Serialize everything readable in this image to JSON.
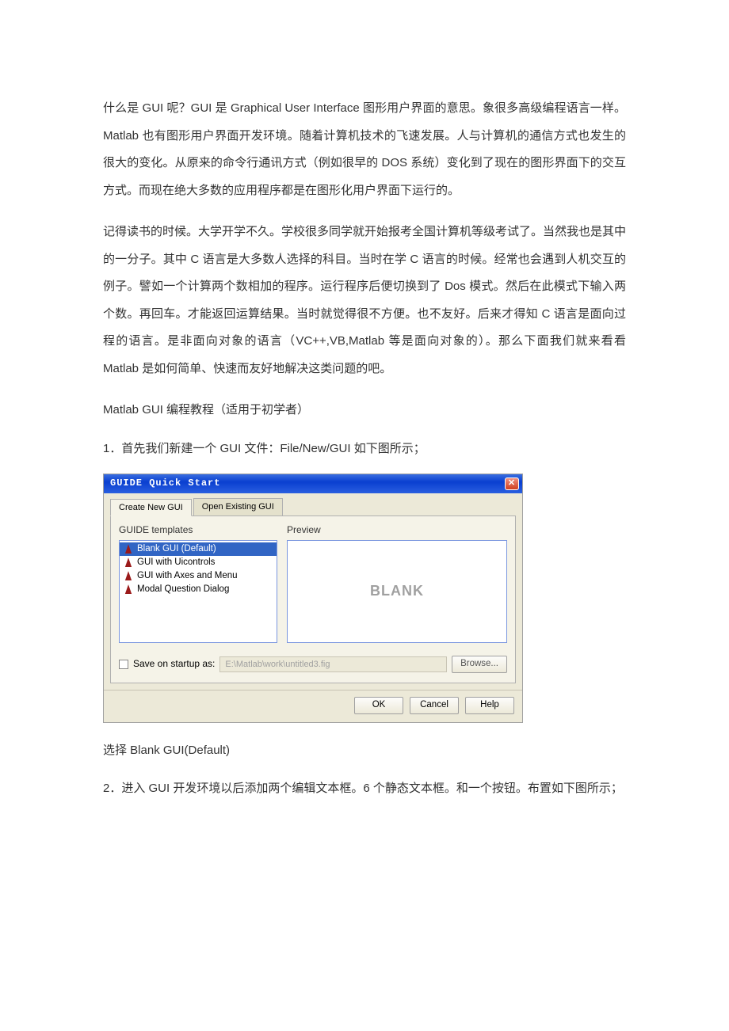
{
  "body": {
    "p1": "什么是 GUI 呢？GUI 是 Graphical User Interface 图形用户界面的意思。象很多高级编程语言一样。Matlab 也有图形用户界面开发环境。随着计算机技术的飞速发展。人与计算机的通信方式也发生的很大的变化。从原来的命令行通讯方式（例如很早的 DOS 系统）变化到了现在的图形界面下的交互方式。而现在绝大多数的应用程序都是在图形化用户界面下运行的。",
    "p2": "记得读书的时候。大学开学不久。学校很多同学就开始报考全国计算机等级考试了。当然我也是其中的一分子。其中 C 语言是大多数人选择的科目。当时在学 C 语言的时候。经常也会遇到人机交互的例子。譬如一个计算两个数相加的程序。运行程序后便切换到了 Dos 模式。然后在此模式下输入两个数。再回车。才能返回运算结果。当时就觉得很不方便。也不友好。后来才得知 C 语言是面向过程的语言。是非面向对象的语言（VC++,VB,Matlab 等是面向对象的）。那么下面我们就来看看 Matlab 是如何简单、快速而友好地解决这类问题的吧。",
    "h1": "Matlab GUI 编程教程（适用于初学者）",
    "step1": "1．首先我们新建一个 GUI 文件：File/New/GUI  如下图所示；",
    "after1": "选择 Blank GUI(Default)",
    "step2": "2．进入 GUI 开发环境以后添加两个编辑文本框。6 个静态文本框。和一个按钮。布置如下图所示；"
  },
  "dialog": {
    "title": "GUIDE Quick Start",
    "close_glyph": "✕",
    "tab_create": "Create New GUI",
    "tab_open": "Open Existing GUI",
    "templates_label": "GUIDE templates",
    "preview_label": "Preview",
    "items": {
      "i0": "Blank GUI (Default)",
      "i1": "GUI with Uicontrols",
      "i2": "GUI with Axes and Menu",
      "i3": "Modal Question Dialog"
    },
    "preview_text": "BLANK",
    "save_label": "Save on startup as:",
    "save_path": "E:\\Matlab\\work\\untitled3.fig",
    "browse": "Browse...",
    "ok": "OK",
    "cancel": "Cancel",
    "help": "Help"
  }
}
